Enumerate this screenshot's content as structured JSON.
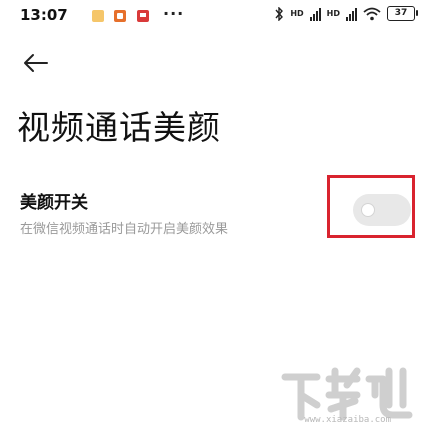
{
  "status_bar": {
    "time": "13:07",
    "more": "···",
    "signal_label_1": "HD",
    "signal_label_2": "HD",
    "battery": "37"
  },
  "header": {
    "back_icon": "arrow-left-icon"
  },
  "page": {
    "title": "视频通话美颜"
  },
  "setting": {
    "title": "美颜开关",
    "description": "在微信视频通话时自动开启美颜效果",
    "toggle_on": false
  },
  "watermark": {
    "url": "www.xiazaiba.com"
  },
  "colors": {
    "highlight": "#d9232f",
    "toggle_off": "#e8e8e8",
    "desc_text": "#9a9a9a"
  }
}
